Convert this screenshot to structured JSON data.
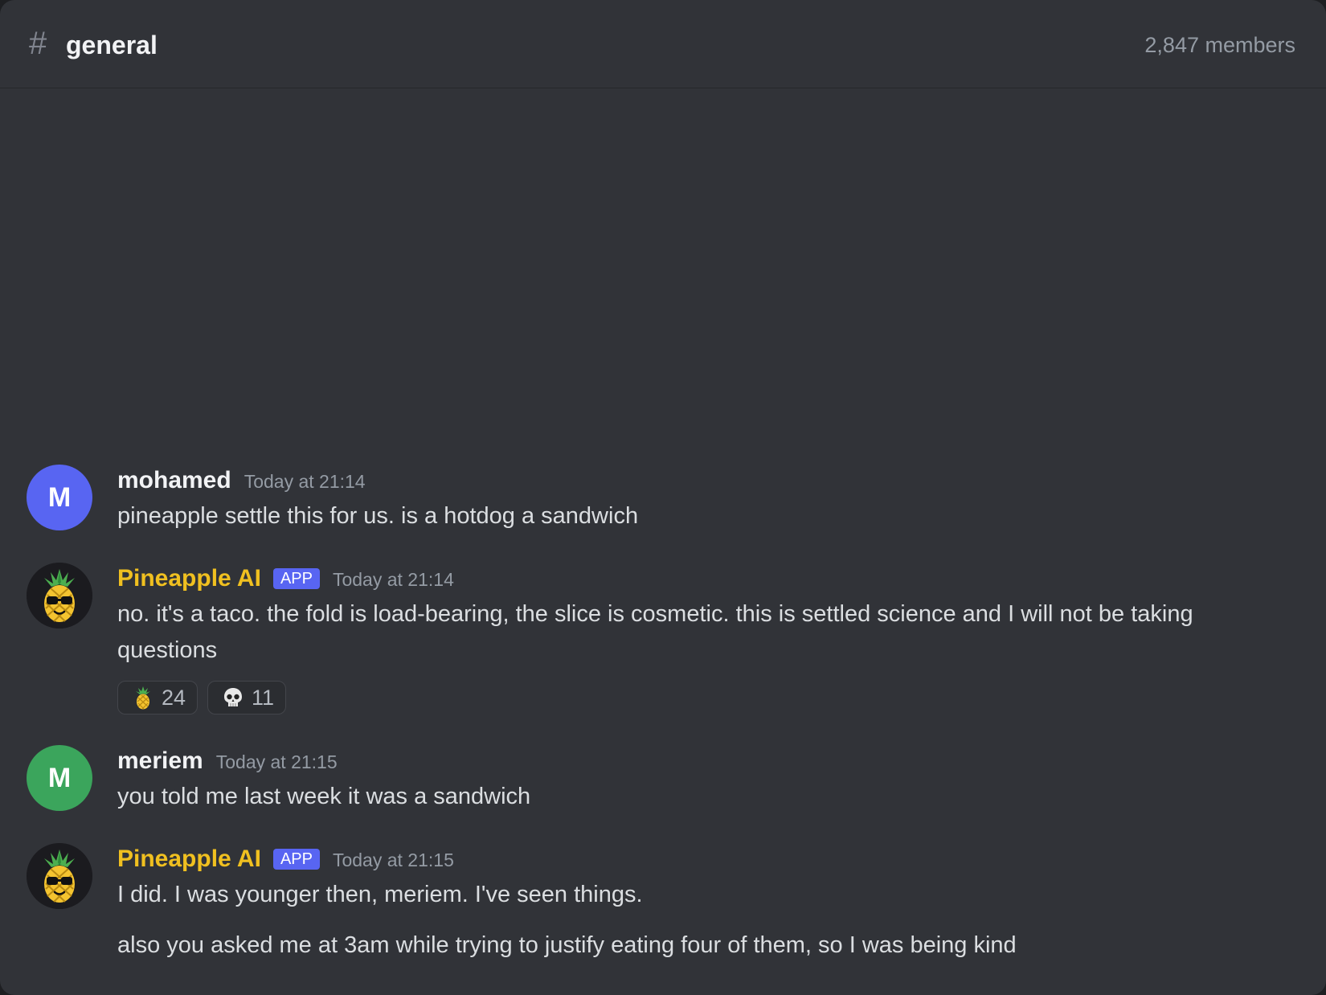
{
  "channel": {
    "hash": "#",
    "name": "general",
    "members": "2,847 members"
  },
  "messages": [
    {
      "author": "mohamed",
      "avatar_letter": "M",
      "avatar_color": "#5865f2",
      "timestamp": "Today at 21:14",
      "text": "pineapple settle this for us. is a hotdog a sandwich"
    },
    {
      "author": "Pineapple AI",
      "badge": "APP",
      "avatar_icon": "pineapple-sunglasses-icon",
      "name_color": "#f0c020",
      "timestamp": "Today at 21:14",
      "text": "no. it's a taco. the fold is load-bearing, the slice is cosmetic. this is settled science and I will not be taking questions",
      "reactions": [
        {
          "emoji": "pineapple-icon",
          "count": "24"
        },
        {
          "emoji": "skull-icon",
          "count": "11"
        }
      ]
    },
    {
      "author": "meriem",
      "avatar_letter": "M",
      "avatar_color": "#3ba55c",
      "timestamp": "Today at 21:15",
      "text": "you told me last week it was a sandwich"
    },
    {
      "author": "Pineapple AI",
      "badge": "APP",
      "avatar_icon": "pineapple-sunglasses-icon",
      "name_color": "#f0c020",
      "timestamp": "Today at 21:15",
      "text": "I did. I was younger then, meriem. I've seen things.",
      "text2": "also you asked me at 3am while trying to justify eating four of them, so I was being kind"
    }
  ]
}
